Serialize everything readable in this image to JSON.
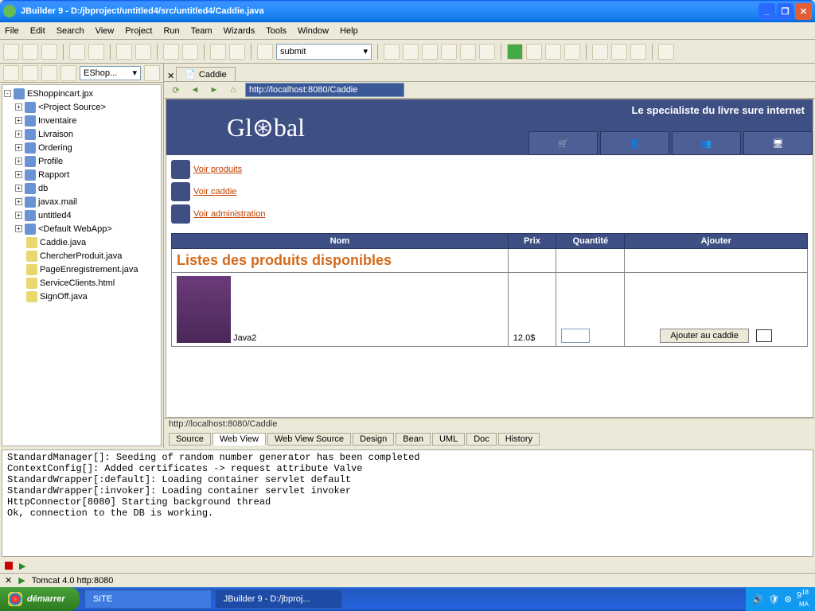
{
  "window": {
    "title": "JBuilder 9 - D:/jbproject/untitled4/src/untitled4/Caddie.java"
  },
  "menu": [
    "File",
    "Edit",
    "Search",
    "View",
    "Project",
    "Run",
    "Team",
    "Wizards",
    "Tools",
    "Window",
    "Help"
  ],
  "combo_value": "submit",
  "project_dropdown": "EShop...",
  "tree": [
    {
      "exp": "-",
      "icon": "proj",
      "label": "EShoppincart.jpx",
      "indent": 0
    },
    {
      "exp": "+",
      "icon": "pkg",
      "label": "<Project Source>",
      "indent": 1
    },
    {
      "exp": "+",
      "icon": "pkg",
      "label": "Inventaire",
      "indent": 1
    },
    {
      "exp": "+",
      "icon": "pkg",
      "label": "Livraison",
      "indent": 1
    },
    {
      "exp": "+",
      "icon": "pkg",
      "label": "Ordering",
      "indent": 1
    },
    {
      "exp": "+",
      "icon": "pkg",
      "label": "Profile",
      "indent": 1
    },
    {
      "exp": "+",
      "icon": "pkg",
      "label": "Rapport",
      "indent": 1
    },
    {
      "exp": "+",
      "icon": "pkg",
      "label": "db",
      "indent": 1
    },
    {
      "exp": "+",
      "icon": "pkg",
      "label": "javax.mail",
      "indent": 1
    },
    {
      "exp": "+",
      "icon": "pkg",
      "label": "untitled4",
      "indent": 1
    },
    {
      "exp": "+",
      "icon": "web",
      "label": "<Default WebApp>",
      "indent": 1
    },
    {
      "exp": "",
      "icon": "file",
      "label": "Caddie.java",
      "indent": 1
    },
    {
      "exp": "",
      "icon": "file",
      "label": "ChercherProduit.java",
      "indent": 1
    },
    {
      "exp": "",
      "icon": "file",
      "label": "PageEnregistrement.java",
      "indent": 1
    },
    {
      "exp": "",
      "icon": "file",
      "label": "ServiceClients.html",
      "indent": 1
    },
    {
      "exp": "",
      "icon": "file",
      "label": "SignOff.java",
      "indent": 1
    }
  ],
  "editor_tab": "Caddie",
  "url": "http://localhost:8080/Caddie",
  "page": {
    "logo": "Gl⊛bal",
    "slogan": "Le specialiste du livre sure internet",
    "links": [
      {
        "label": "Voir produits"
      },
      {
        "label": "Voir caddie"
      },
      {
        "label": "Voir administration"
      }
    ],
    "table": {
      "headers": [
        "Nom",
        "Prix",
        "Quantité",
        "Ajouter"
      ],
      "list_header": "Listes des produits disponibles",
      "rows": [
        {
          "name": "Java2",
          "price": "12.0$",
          "add_label": "Ajouter au caddie"
        }
      ]
    }
  },
  "status_url": "http://localhost:8080/Caddie",
  "view_tabs": [
    "Source",
    "Web View",
    "Web View Source",
    "Design",
    "Bean",
    "UML",
    "Doc",
    "History"
  ],
  "active_view_tab": "Web View",
  "console_lines": [
    "StandardManager[]: Seeding of random number generator has been completed",
    "ContextConfig[]: Added certificates -> request attribute Valve",
    "StandardWrapper[:default]: Loading container servlet default",
    "StandardWrapper[:invoker]: Loading container servlet invoker",
    "HttpConnector[8080] Starting background thread",
    "Ok, connection to the DB is working."
  ],
  "server_label": "Tomcat 4.0 http:8080",
  "taskbar": {
    "start": "démarrer",
    "buttons": [
      {
        "label": "SITE",
        "active": false
      },
      {
        "label": "JBuilder 9 - D:/jbproj...",
        "active": true
      }
    ],
    "clock_time": "9",
    "clock_min": "18",
    "clock_ampm": "MA"
  }
}
